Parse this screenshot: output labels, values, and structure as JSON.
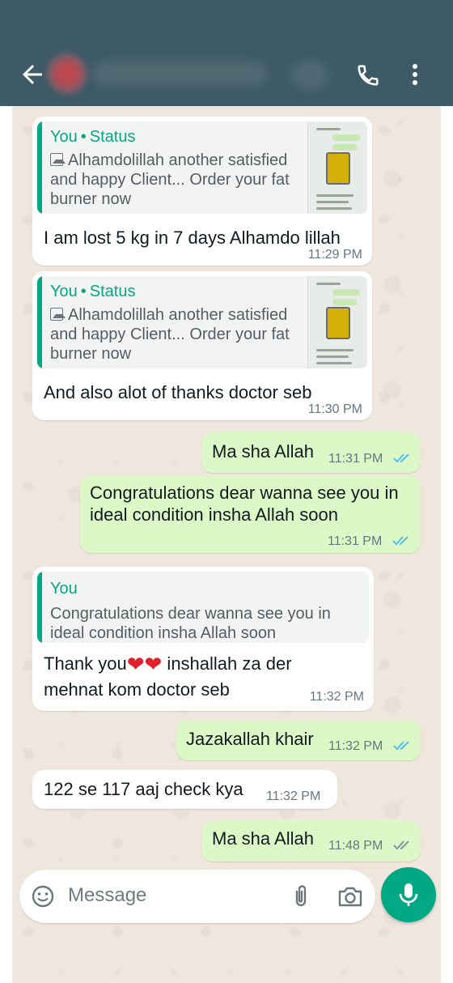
{
  "header": {
    "contact_name_blurred": true
  },
  "messages": [
    {
      "direction": "in",
      "reply": {
        "who": "You",
        "sep": "•",
        "kind": "Status",
        "snippet": "Alhamdolillah another satisfied and happy Client... Order your fat burner now"
      },
      "text": "I am lost 5 kg in 7 days Alhamdo lillah",
      "time": "11:29 PM"
    },
    {
      "direction": "in",
      "reply": {
        "who": "You",
        "sep": "•",
        "kind": "Status",
        "snippet": "Alhamdolillah another satisfied and happy Client... Order your fat burner now"
      },
      "text": "And also alot of thanks doctor seb",
      "time": "11:30 PM"
    },
    {
      "direction": "out",
      "text": "Ma sha Allah",
      "time": "11:31 PM",
      "status": "read"
    },
    {
      "direction": "out",
      "text_line1": "Congratulations dear wanna see you in",
      "text_line2": "ideal condition insha Allah soon",
      "time": "11:31 PM",
      "status": "read"
    },
    {
      "direction": "in",
      "reply": {
        "who": "You",
        "snippet_line1": "Congratulations dear wanna see you in",
        "snippet_line2": "ideal condition insha Allah soon"
      },
      "text_line1_a": "Thank you",
      "hearts": "❤❤",
      "text_line1_b": " inshallah za der",
      "text_line2": "mehnat kom doctor seb",
      "time": "11:32 PM"
    },
    {
      "direction": "out",
      "text": "Jazakallah khair",
      "time": "11:32 PM",
      "status": "read"
    },
    {
      "direction": "in",
      "text": "122 se 117 aaj check kya",
      "time": "11:32 PM"
    },
    {
      "direction": "out",
      "text": "Ma sha Allah",
      "time": "11:48 PM",
      "status": "delivered"
    }
  ],
  "composer": {
    "placeholder": "Message"
  },
  "icons": {
    "back": "arrow-left-icon",
    "call": "phone-icon",
    "more": "more-vertical-icon",
    "emoji": "emoji-icon",
    "attach": "paperclip-icon",
    "camera": "camera-icon",
    "mic": "microphone-icon"
  },
  "colors": {
    "header": "#3d5a66",
    "chat_bg": "#efe7dd",
    "outgoing": "#dcf8c6",
    "incoming": "#ffffff",
    "accent": "#06a884",
    "read_tick": "#53bdeb",
    "delivered_tick": "#8696a0",
    "mic_button": "#00a884"
  }
}
